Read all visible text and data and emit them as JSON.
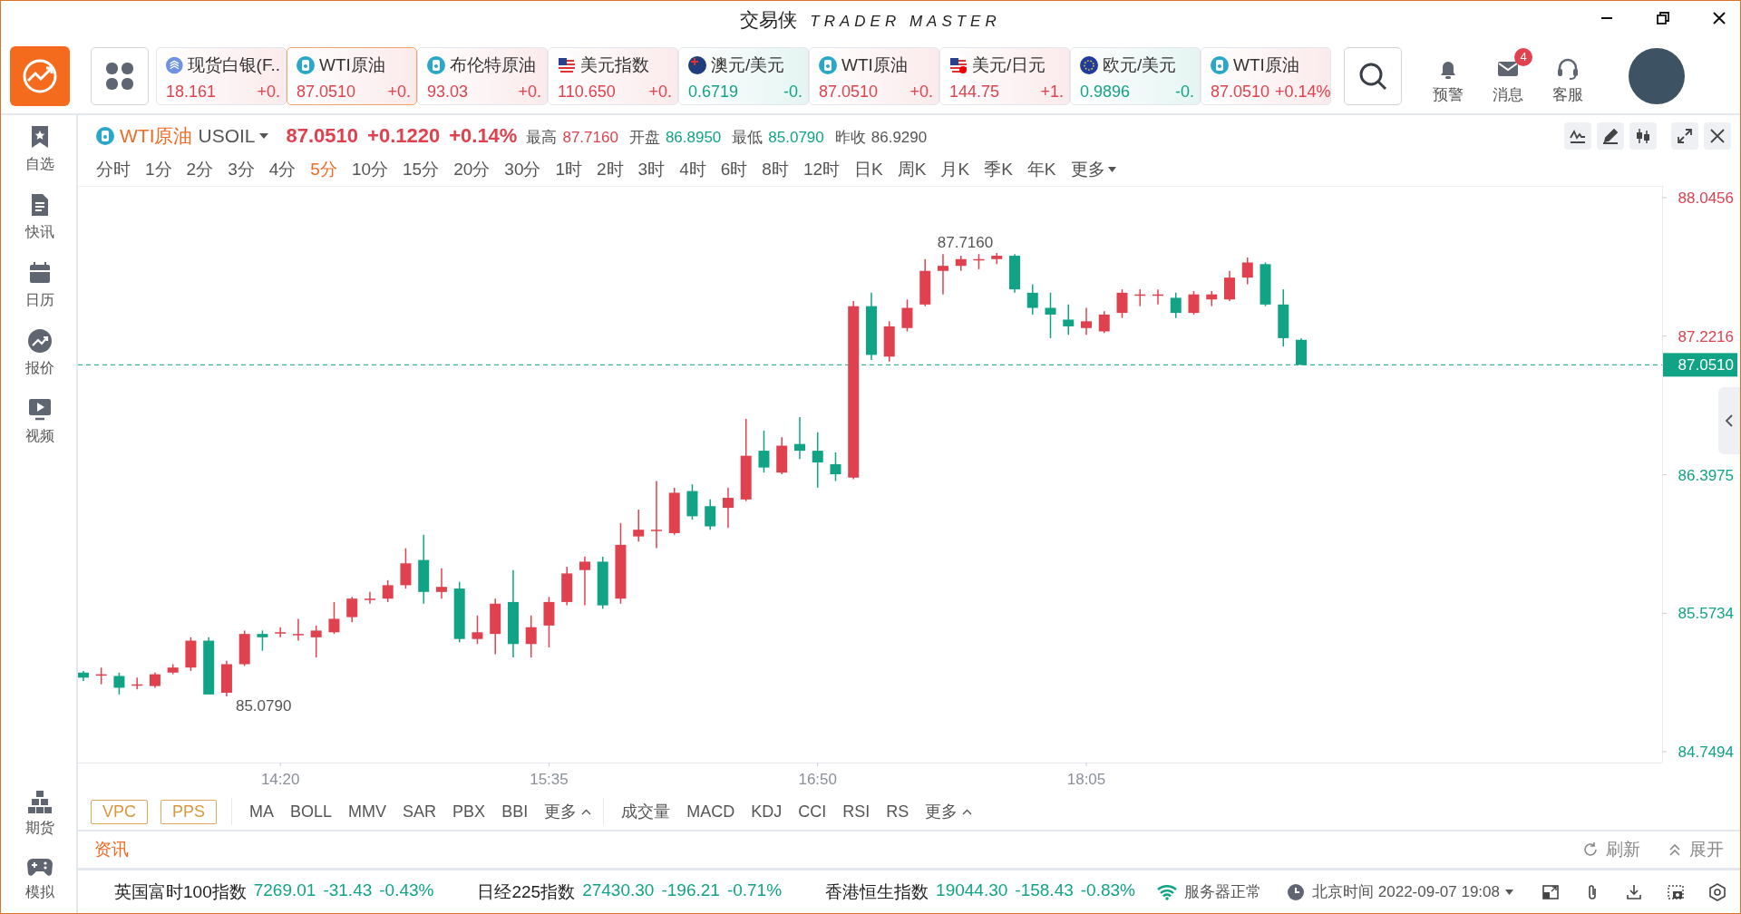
{
  "window": {
    "title": "交易侠",
    "subtitle": "TRADER MASTER"
  },
  "tickers": [
    {
      "kind": "coin",
      "name": "现货白银(F..",
      "price": "18.161",
      "change": "+0.",
      "color": "#e0414f",
      "selected": false
    },
    {
      "kind": "oil",
      "name": "WTI原油",
      "price": "87.0510",
      "change": "+0.",
      "color": "#e0414f",
      "selected": true
    },
    {
      "kind": "oil",
      "name": "布伦特原油",
      "price": "93.03",
      "change": "+0.",
      "color": "#e0414f",
      "selected": false
    },
    {
      "kind": "flag-us",
      "name": "美元指数",
      "price": "110.650",
      "change": "+0.",
      "color": "#e0414f",
      "selected": false
    },
    {
      "kind": "flag-au",
      "name": "澳元/美元",
      "price": "0.6719",
      "change": "-0.",
      "color": "#11a385",
      "selected": false
    },
    {
      "kind": "oil",
      "name": "WTI原油",
      "price": "87.0510",
      "change": "+0.",
      "color": "#e0414f",
      "selected": false
    },
    {
      "kind": "flag-jp",
      "name": "美元/日元",
      "price": "144.75",
      "change": "+1.",
      "color": "#e0414f",
      "selected": false
    },
    {
      "kind": "flag-eu",
      "name": "欧元/美元",
      "price": "0.9896",
      "change": "-0.",
      "color": "#11a385",
      "selected": false
    },
    {
      "kind": "oil",
      "name": "WTI原油",
      "price": "87.0510",
      "change": "+0.14%",
      "color": "#e0414f",
      "selected": false
    }
  ],
  "toolbar_actions": [
    {
      "kind": "bell",
      "label": "预警"
    },
    {
      "kind": "mail",
      "label": "消息",
      "badge": "4"
    },
    {
      "kind": "headset",
      "label": "客服"
    }
  ],
  "sidebar": {
    "top": [
      {
        "kind": "bookmark",
        "label": "自选"
      },
      {
        "kind": "document",
        "label": "快讯"
      },
      {
        "kind": "calendar",
        "label": "日历"
      },
      {
        "kind": "trend",
        "label": "报价"
      },
      {
        "kind": "video",
        "label": "视频"
      }
    ],
    "bottom": [
      {
        "kind": "stack",
        "label": "期货"
      },
      {
        "kind": "gamepad",
        "label": "模拟"
      }
    ]
  },
  "quote": {
    "name": "WTI原油",
    "code": "USOIL",
    "price": "87.0510",
    "change": "+0.1220",
    "percent": "+0.14%",
    "stats": [
      {
        "label": "最高",
        "value": "87.7160",
        "color": "#e0414f"
      },
      {
        "label": "开盘",
        "value": "86.8950",
        "color": "#11a385"
      },
      {
        "label": "最低",
        "value": "85.0790",
        "color": "#11a385"
      },
      {
        "label": "昨收",
        "value": "86.9290",
        "color": "#555555"
      }
    ]
  },
  "periods": [
    {
      "label": "分时",
      "selected": false
    },
    {
      "label": "1分",
      "selected": false
    },
    {
      "label": "2分",
      "selected": false
    },
    {
      "label": "3分",
      "selected": false
    },
    {
      "label": "4分",
      "selected": false
    },
    {
      "label": "5分",
      "selected": true
    },
    {
      "label": "10分",
      "selected": false
    },
    {
      "label": "15分",
      "selected": false
    },
    {
      "label": "20分",
      "selected": false
    },
    {
      "label": "30分",
      "selected": false
    },
    {
      "label": "1时",
      "selected": false
    },
    {
      "label": "2时",
      "selected": false
    },
    {
      "label": "3时",
      "selected": false
    },
    {
      "label": "4时",
      "selected": false
    },
    {
      "label": "6时",
      "selected": false
    },
    {
      "label": "8时",
      "selected": false
    },
    {
      "label": "12时",
      "selected": false
    },
    {
      "label": "日K",
      "selected": false
    },
    {
      "label": "周K",
      "selected": false
    },
    {
      "label": "月K",
      "selected": false
    },
    {
      "label": "季K",
      "selected": false
    },
    {
      "label": "年K",
      "selected": false
    }
  ],
  "periods_more": "更多",
  "chart": {
    "chart_data": {
      "type": "candlestick",
      "ylim": [
        84.6847,
        88.1157
      ],
      "ref_lines": [
        {
          "axis": "y",
          "value": 87.051,
          "label": "87.0510",
          "color": "#11a385"
        }
      ],
      "yticks": [
        {
          "value": 88.0456,
          "label": "88.0456"
        },
        {
          "value": 87.2216,
          "label": "87.2216"
        },
        {
          "value": 86.3975,
          "label": "86.3975"
        },
        {
          "value": 85.5734,
          "label": "85.5734"
        },
        {
          "value": 84.7494,
          "label": "84.7494"
        }
      ],
      "xlim": [
        803.5,
        1245.75
      ],
      "xticks": [
        {
          "value": 860,
          "label": "14:20"
        },
        {
          "value": 935,
          "label": "15:35"
        },
        {
          "value": 1010,
          "label": "16:50"
        },
        {
          "value": 1085,
          "label": "18:05"
        }
      ],
      "x": [
        805,
        810,
        815,
        820,
        825,
        830,
        835,
        840,
        845,
        850,
        855,
        860,
        865,
        870,
        875,
        880,
        885,
        890,
        895,
        900,
        905,
        910,
        915,
        920,
        925,
        930,
        935,
        940,
        945,
        950,
        955,
        960,
        965,
        970,
        975,
        980,
        985,
        990,
        995,
        1000,
        1005,
        1010,
        1015,
        1020,
        1025,
        1030,
        1035,
        1040,
        1045,
        1050,
        1055,
        1060,
        1065,
        1070,
        1075,
        1080,
        1085,
        1090,
        1095,
        1100,
        1105,
        1110,
        1115,
        1120,
        1125,
        1130,
        1135,
        1140,
        1145
      ],
      "annotations": [
        {
          "text": "87.7160",
          "x": 1060,
          "y": 87.716
        },
        {
          "text": "85.0790",
          "x": 845,
          "y": 85.079
        }
      ],
      "ohlc": [
        [
          85.22,
          85.23,
          85.17,
          85.19
        ],
        [
          85.21,
          85.25,
          85.15,
          85.21
        ],
        [
          85.2,
          85.22,
          85.09,
          85.13
        ],
        [
          85.15,
          85.19,
          85.12,
          85.15
        ],
        [
          85.14,
          85.22,
          85.13,
          85.21
        ],
        [
          85.22,
          85.27,
          85.21,
          85.25
        ],
        [
          85.25,
          85.43,
          85.23,
          85.41
        ],
        [
          85.41,
          85.43,
          85.09,
          85.09
        ],
        [
          85.1,
          85.29,
          85.079,
          85.27
        ],
        [
          85.27,
          85.47,
          85.26,
          85.45
        ],
        [
          85.45,
          85.47,
          85.35,
          85.43
        ],
        [
          85.46,
          85.49,
          85.43,
          85.46
        ],
        [
          85.45,
          85.54,
          85.41,
          85.45
        ],
        [
          85.43,
          85.5,
          85.31,
          85.47
        ],
        [
          85.46,
          85.64,
          85.45,
          85.54
        ],
        [
          85.55,
          85.67,
          85.52,
          85.66
        ],
        [
          85.66,
          85.7,
          85.63,
          85.66
        ],
        [
          85.66,
          85.77,
          85.64,
          85.74
        ],
        [
          85.74,
          85.96,
          85.72,
          85.87
        ],
        [
          85.89,
          86.04,
          85.63,
          85.7
        ],
        [
          85.7,
          85.84,
          85.66,
          85.73
        ],
        [
          85.72,
          85.76,
          85.4,
          85.42
        ],
        [
          85.42,
          85.56,
          85.39,
          85.46
        ],
        [
          85.45,
          85.66,
          85.33,
          85.63
        ],
        [
          85.64,
          85.83,
          85.31,
          85.39
        ],
        [
          85.39,
          85.56,
          85.31,
          85.49
        ],
        [
          85.5,
          85.67,
          85.37,
          85.64
        ],
        [
          85.64,
          85.85,
          85.62,
          85.81
        ],
        [
          85.83,
          85.91,
          85.62,
          85.88
        ],
        [
          85.88,
          85.91,
          85.6,
          85.62
        ],
        [
          85.66,
          86.11,
          85.63,
          85.98
        ],
        [
          86.03,
          86.19,
          86.0,
          86.07
        ],
        [
          86.07,
          86.36,
          85.96,
          86.07
        ],
        [
          86.05,
          86.32,
          86.04,
          86.29
        ],
        [
          86.3,
          86.34,
          86.13,
          86.15
        ],
        [
          86.21,
          86.25,
          86.07,
          86.09
        ],
        [
          86.2,
          86.32,
          86.08,
          86.26
        ],
        [
          86.25,
          86.73,
          86.24,
          86.51
        ],
        [
          86.54,
          86.66,
          86.41,
          86.44
        ],
        [
          86.41,
          86.62,
          86.4,
          86.57
        ],
        [
          86.58,
          86.74,
          86.49,
          86.54
        ],
        [
          86.54,
          86.65,
          86.32,
          86.47
        ],
        [
          86.46,
          86.53,
          86.36,
          86.4
        ],
        [
          86.38,
          87.43,
          86.37,
          87.4
        ],
        [
          87.4,
          87.48,
          87.08,
          87.11
        ],
        [
          87.1,
          87.31,
          87.07,
          87.28
        ],
        [
          87.27,
          87.44,
          87.25,
          87.39
        ],
        [
          87.41,
          87.68,
          87.4,
          87.61
        ],
        [
          87.61,
          87.71,
          87.47,
          87.64
        ],
        [
          87.64,
          87.7,
          87.61,
          87.68
        ],
        [
          87.68,
          87.71,
          87.62,
          87.68
        ],
        [
          87.68,
          87.716,
          87.65,
          87.7
        ],
        [
          87.7,
          87.71,
          87.48,
          87.5
        ],
        [
          87.48,
          87.53,
          87.35,
          87.39
        ],
        [
          87.39,
          87.48,
          87.21,
          87.35
        ],
        [
          87.32,
          87.41,
          87.23,
          87.28
        ],
        [
          87.27,
          87.39,
          87.23,
          87.31
        ],
        [
          87.25,
          87.37,
          87.24,
          87.35
        ],
        [
          87.36,
          87.5,
          87.33,
          87.48
        ],
        [
          87.47,
          87.5,
          87.4,
          87.47
        ],
        [
          87.47,
          87.5,
          87.41,
          87.47
        ],
        [
          87.45,
          87.48,
          87.33,
          87.36
        ],
        [
          87.36,
          87.49,
          87.35,
          87.47
        ],
        [
          87.44,
          87.49,
          87.4,
          87.47
        ],
        [
          87.44,
          87.61,
          87.43,
          87.57
        ],
        [
          87.57,
          87.69,
          87.53,
          87.66
        ],
        [
          87.65,
          87.66,
          87.4,
          87.41
        ],
        [
          87.41,
          87.5,
          87.16,
          87.21
        ],
        [
          87.2,
          87.21,
          87.05,
          87.051
        ]
      ]
    }
  },
  "indicators": {
    "boxed": [
      "VPC",
      "PPS"
    ],
    "main": [
      "MA",
      "BOLL",
      "MMV",
      "SAR",
      "PBX",
      "BBI"
    ],
    "main_more": "更多",
    "sub": [
      "成交量",
      "MACD",
      "KDJ",
      "CCI",
      "RSI",
      "RS"
    ],
    "sub_more": "更多"
  },
  "news": {
    "title": "资讯",
    "refresh": "刷新",
    "expand": "展开"
  },
  "status_bar": {
    "indices": [
      {
        "name": "英国富时100指数",
        "value": "7269.01",
        "change": "-31.43",
        "percent": "-0.43%",
        "color": "#11a385"
      },
      {
        "name": "日经225指数",
        "value": "27430.30",
        "change": "-196.21",
        "percent": "-0.71%",
        "color": "#11a385"
      },
      {
        "name": "香港恒生指数",
        "value": "19044.30",
        "change": "-158.43",
        "percent": "-0.83%",
        "color": "#11a385"
      }
    ],
    "server": "服务器正常",
    "clock": "北京时间 2022-09-07 19:08"
  }
}
